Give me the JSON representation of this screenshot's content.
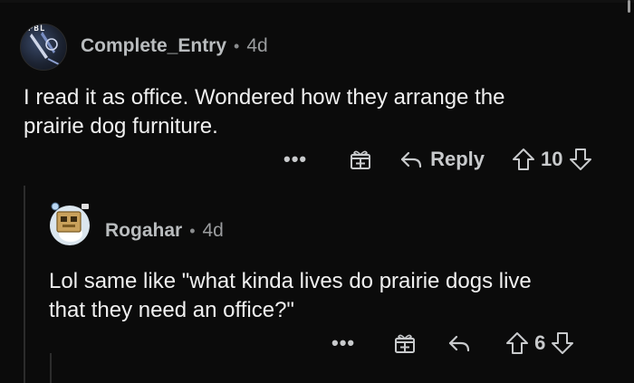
{
  "comments": [
    {
      "username": "Complete_Entry",
      "time": "4d",
      "avatar_tag": "PBL",
      "text_lines": [
        "I read it as office. Wondered how they arrange the",
        "prairie dog furniture."
      ],
      "actions": {
        "more": "•••",
        "reply": "Reply",
        "votes": "10"
      }
    },
    {
      "username": "Rogahar",
      "time": "4d",
      "text_lines": [
        "Lol same like \"what kinda lives do prairie dogs live",
        "that they need an office?\""
      ],
      "actions": {
        "more": "•••",
        "votes": "6"
      }
    }
  ],
  "separator": "•",
  "colors": {
    "background": "#0b0b0b",
    "text": "#f0f0f0",
    "muted": "#9a9c9e",
    "accent": "#c8cacc"
  },
  "icons": [
    "gift-icon",
    "reply-arrow-icon",
    "upvote-icon",
    "downvote-icon"
  ]
}
